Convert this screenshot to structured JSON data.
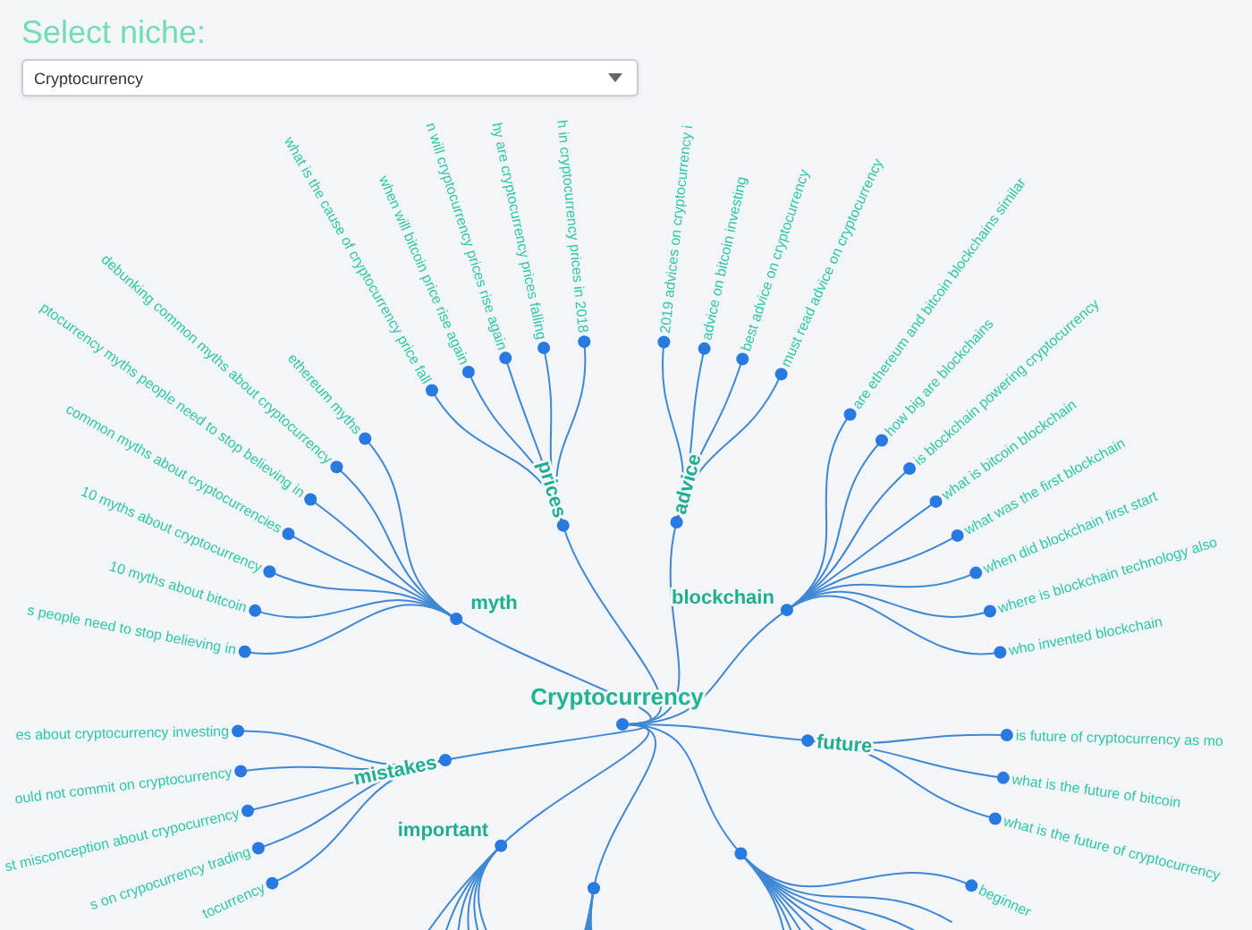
{
  "niche_label": "Select niche:",
  "niche_select": {
    "value": "Cryptocurrency"
  },
  "tree": {
    "root": "Cryptocurrency",
    "branches": [
      {
        "label": "myth",
        "children": [
          {
            "label": "ethereum myths"
          },
          {
            "label": "debunking common myths about cryptocurrency"
          },
          {
            "label": "ptocurrency myths people need to stop believing in"
          },
          {
            "label": "common myths about cryptocurrencies"
          },
          {
            "label": "10 myths about cryptocurrency"
          },
          {
            "label": "10 myths about bitcoin"
          },
          {
            "label": "s people need to stop believing in"
          }
        ]
      },
      {
        "label": "prices",
        "children": [
          {
            "label": "what is the cause of cryptocurrency price fall"
          },
          {
            "label": "when will bitcoin price rise again"
          },
          {
            "label": "n will cryptocurrency prices rise again"
          },
          {
            "label": "hy are cryptocurrency prices falling"
          },
          {
            "label": "h in cryptocurrency prices in 2018"
          }
        ]
      },
      {
        "label": "advice",
        "children": [
          {
            "label": "2019 advices on cryptocurrency i"
          },
          {
            "label": "advice on bitcoin investing"
          },
          {
            "label": "best advice on cryptocurrency"
          },
          {
            "label": "must read advice on cryptocurrency"
          }
        ]
      },
      {
        "label": "blockchain",
        "children": [
          {
            "label": "are ethereum and bitcoin blockchains similar"
          },
          {
            "label": "how big are blockchains"
          },
          {
            "label": "is blockchain powering cryptocurrency"
          },
          {
            "label": "what is bitcoin blockchain"
          },
          {
            "label": "what was the first blockchain"
          },
          {
            "label": "when did blockchain first start"
          },
          {
            "label": "where is blockchain technology also"
          },
          {
            "label": "who invented blockchain"
          }
        ]
      },
      {
        "label": "future",
        "children": [
          {
            "label": "is future of cryptocurrency as mo"
          },
          {
            "label": "what is the future of bitcoin"
          },
          {
            "label": "what is the future of cryptocurrency"
          }
        ]
      },
      {
        "children": [
          {
            "label": "beginner"
          }
        ]
      },
      {
        "label": "important"
      },
      {
        "label": "mistakes",
        "children": [
          {
            "label": "es about cryptocurrency investing"
          },
          {
            "label": "ould not commit on cryptocurrency"
          },
          {
            "label": "st misconception about crypocurrency"
          },
          {
            "label": "s on crypocurrency trading"
          },
          {
            "label": "tocurrency"
          }
        ]
      }
    ]
  }
}
